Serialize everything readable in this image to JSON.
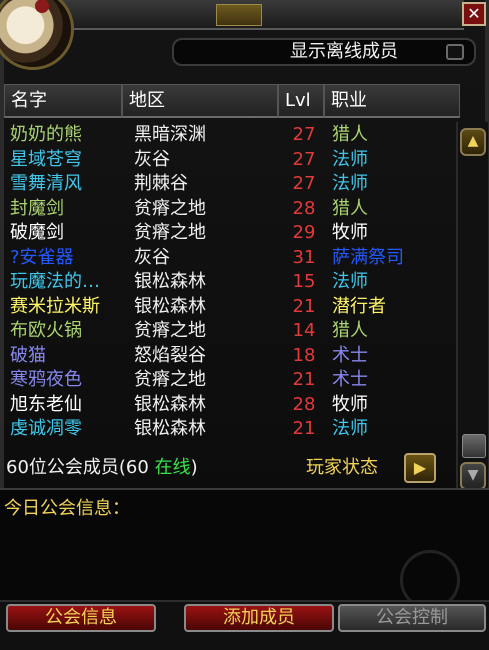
{
  "title_bar": {
    "title": ""
  },
  "offline": {
    "label": "显示离线成员",
    "checked": false
  },
  "columns": {
    "name": "名字",
    "zone": "地区",
    "level": "Lvl",
    "class": "职业"
  },
  "roster": [
    {
      "name": "奶奶的熊",
      "zone": "黑暗深渊",
      "level": "27",
      "class": "猎人",
      "name_color": "#a9d271",
      "class_color": "#a9d271"
    },
    {
      "name": "星域苍穹",
      "zone": "灰谷",
      "level": "27",
      "class": "法师",
      "name_color": "#40c7eb",
      "class_color": "#40c7eb"
    },
    {
      "name": "雪舞清风",
      "zone": "荆棘谷",
      "level": "27",
      "class": "法师",
      "name_color": "#40c7eb",
      "class_color": "#40c7eb"
    },
    {
      "name": "封魔剑",
      "zone": "贫瘠之地",
      "level": "28",
      "class": "猎人",
      "name_color": "#a9d271",
      "class_color": "#a9d271"
    },
    {
      "name": "破魔剑",
      "zone": "贫瘠之地",
      "level": "29",
      "class": "牧师",
      "name_color": "#ffffff",
      "class_color": "#ffffff"
    },
    {
      "name": "?安雀器",
      "zone": "灰谷",
      "level": "31",
      "class": "萨满祭司",
      "name_color": "#2459ff",
      "class_color": "#2459ff"
    },
    {
      "name": "玩魔法的…",
      "zone": "银松森林",
      "level": "15",
      "class": "法师",
      "name_color": "#40c7eb",
      "class_color": "#40c7eb"
    },
    {
      "name": "赛米拉米斯",
      "zone": "银松森林",
      "level": "21",
      "class": "潜行者",
      "name_color": "#fff569",
      "class_color": "#fff569"
    },
    {
      "name": "布欧火锅",
      "zone": "贫瘠之地",
      "level": "14",
      "class": "猎人",
      "name_color": "#a9d271",
      "class_color": "#a9d271"
    },
    {
      "name": "破猫",
      "zone": "怒焰裂谷",
      "level": "18",
      "class": "术士",
      "name_color": "#8787ed",
      "class_color": "#8787ed"
    },
    {
      "name": "寒鸦夜色",
      "zone": "贫瘠之地",
      "level": "21",
      "class": "术士",
      "name_color": "#8787ed",
      "class_color": "#8787ed"
    },
    {
      "name": "旭东老仙",
      "zone": "银松森林",
      "level": "28",
      "class": "牧师",
      "name_color": "#ffffff",
      "class_color": "#ffffff"
    },
    {
      "name": "虔诚凋零",
      "zone": "银松森林",
      "level": "21",
      "class": "法师",
      "name_color": "#40c7eb",
      "class_color": "#40c7eb"
    }
  ],
  "level_color": "#e23a3a",
  "summary": {
    "prefix": "60位公会成员(60 ",
    "online": "在线",
    "suffix": ")"
  },
  "player_status": {
    "label": "玩家状态"
  },
  "motd": {
    "label": "今日公会信息：",
    "text": ""
  },
  "buttons": {
    "guild_info": "公会信息",
    "add_member": "添加成员",
    "guild_control": "公会控制"
  }
}
